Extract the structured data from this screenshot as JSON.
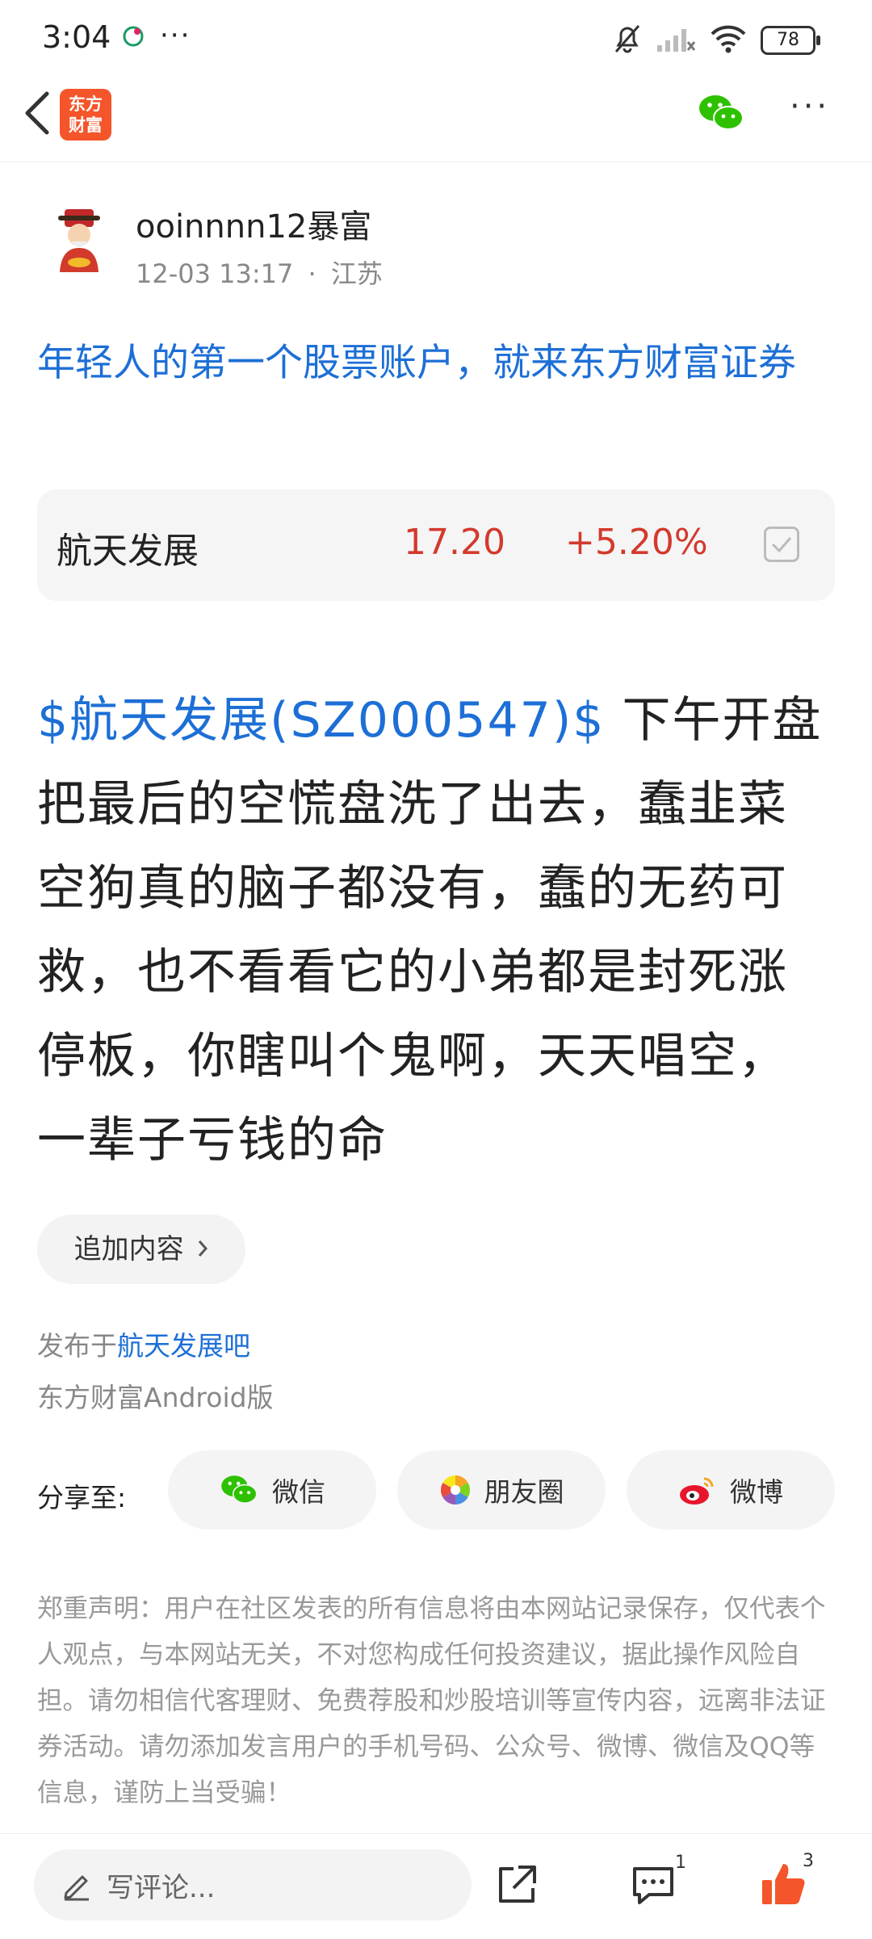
{
  "status_bar": {
    "time": "3:04",
    "more": "···",
    "battery": "78"
  },
  "header": {
    "logo_text_1": "东方",
    "logo_text_2": "财富",
    "more": "···"
  },
  "post": {
    "username": "ooinnnn12暴富",
    "datetime": "12-03 13:17",
    "separator": "·",
    "location": "江苏",
    "ad_text": "年轻人的第一个股票账户，就来东方财富证券",
    "stock": {
      "name": "航天发展",
      "price": "17.20",
      "change": "+5.20%"
    },
    "content_tag": "$航天发展(SZ000547)$",
    "content_body": " 下午开盘把最后的空慌盘洗了出去，蠢韭菜空狗真的脑子都没有，蠢的无药可救，也不看看它的小弟都是封死涨停板，你瞎叫个鬼啊，天天唱空，一辈子亏钱的命",
    "add_content": "追加内容",
    "publish_prefix": "发布于",
    "publish_bar": "航天发展吧",
    "platform": "东方财富Android版"
  },
  "share": {
    "label": "分享至:",
    "wechat": "微信",
    "moments": "朋友圈",
    "weibo": "微博"
  },
  "disclaimer": "郑重声明：用户在社区发表的所有信息将由本网站记录保存，仅代表个人观点，与本网站无关，不对您构成任何投资建议，据此操作风险自担。请勿相信代客理财、免费荐股和炒股培训等宣传内容，远离非法证券活动。请勿添加发言用户的手机号码、公众号、微博、微信及QQ等信息，谨防上当受骗！",
  "bottom_bar": {
    "comment_placeholder": "写评论...",
    "comment_count": "1",
    "like_count": "3"
  },
  "colors": {
    "accent_blue": "#1d6fd6",
    "rise_red": "#d33a2c",
    "like_orange": "#f4552a"
  }
}
